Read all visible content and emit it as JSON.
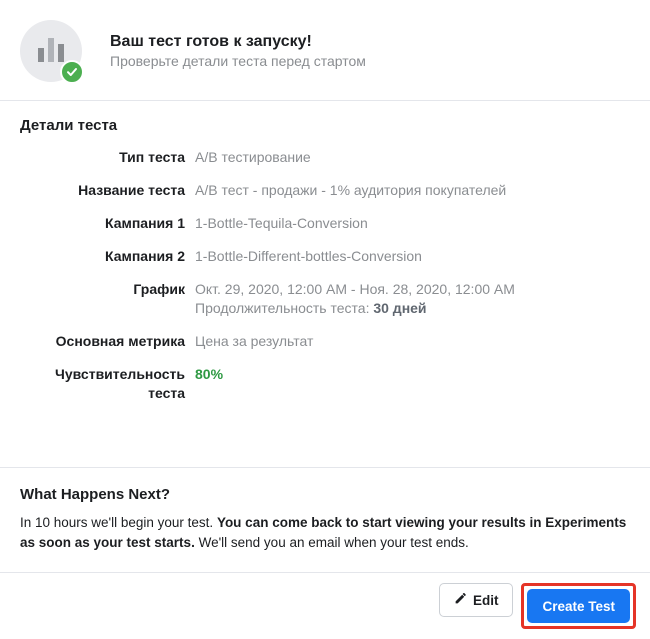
{
  "header": {
    "title": "Ваш тест готов к запуску!",
    "subtitle": "Проверьте детали теста перед стартом",
    "icon": "bar-chart-icon",
    "badge_icon": "check-icon"
  },
  "details": {
    "section_title": "Детали теста",
    "rows": {
      "test_type": {
        "label": "Тип теста",
        "value": "A/B тестирование"
      },
      "test_name": {
        "label": "Название теста",
        "value": "A/B тест - продажи - 1% аудитория покупателей"
      },
      "campaign1": {
        "label": "Кампания 1",
        "value": "1-Bottle-Tequila-Conversion"
      },
      "campaign2": {
        "label": "Кампания 2",
        "value": "1-Bottle-Different-bottles-Conversion"
      },
      "schedule": {
        "label": "График",
        "range": "Окт. 29, 2020, 12:00 AM - Ноя. 28, 2020, 12:00 AM",
        "duration_prefix": "Продолжительность теста: ",
        "duration_value": "30 дней"
      },
      "metric": {
        "label": "Основная метрика",
        "value": "Цена за результат"
      },
      "sensitivity": {
        "label": "Чувствительность теста",
        "value": "80%"
      }
    }
  },
  "next": {
    "title": "What Happens Next?",
    "body_prefix": "In 10 hours we'll begin your test. ",
    "body_bold": "You can come back to start viewing your results in Experiments as soon as your test starts.",
    "body_suffix": " We'll send you an email when your test ends."
  },
  "footer": {
    "edit_label": "Edit",
    "edit_icon": "pencil-icon",
    "create_label": "Create Test"
  }
}
